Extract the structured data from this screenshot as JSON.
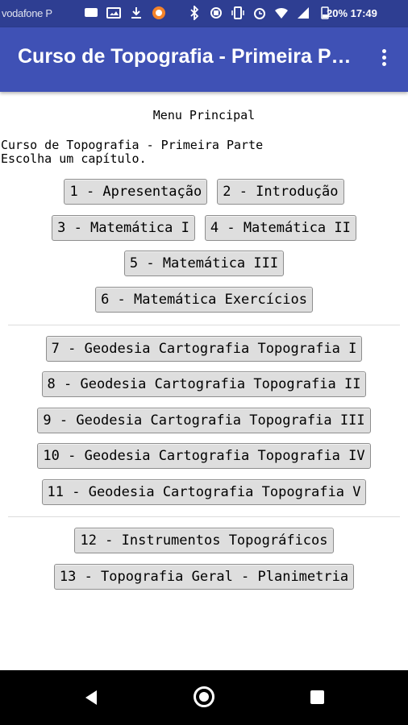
{
  "status_bar": {
    "carrier": "vodafone P",
    "battery": "20% 17:49"
  },
  "app_bar": {
    "title": "Curso de Topografia - Primeira Parte"
  },
  "content": {
    "heading": "Menu Principal",
    "intro_line1": "Curso de Topografia - Primeira Parte",
    "intro_line2": "Escolha um capítulo."
  },
  "buttons": [
    "1 - Apresentação",
    "2 - Introdução",
    "3 - Matemática I",
    "4 - Matemática II",
    "5 - Matemática III",
    "6 - Matemática Exercícios",
    "7 - Geodesia Cartografia Topografia I",
    "8 - Geodesia Cartografia Topografia II",
    "9 - Geodesia Cartografia Topografia III",
    "10 - Geodesia Cartografia Topografia IV",
    "11 - Geodesia Cartografia Topografia V",
    "12 - Instrumentos Topográficos",
    "13 - Topografia Geral - Planimetria"
  ],
  "icons": {
    "overflow": "more-vert-icon",
    "back": "back-icon",
    "home": "home-icon",
    "recents": "recents-icon"
  }
}
